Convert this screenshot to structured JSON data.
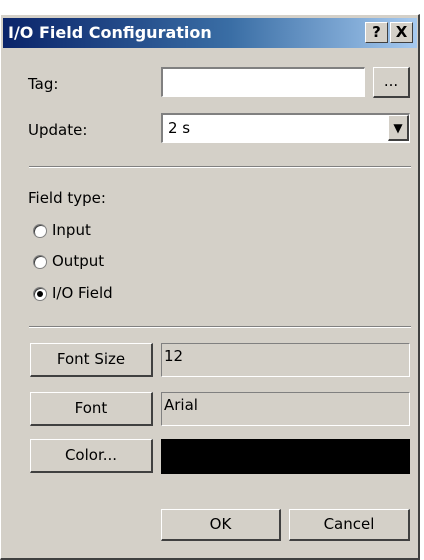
{
  "window": {
    "title": "I/O Field Configuration",
    "help_label": "?",
    "close_label": "X"
  },
  "tag": {
    "label": "Tag:",
    "value": "",
    "browse_label": "..."
  },
  "update": {
    "label": "Update:",
    "value": "2 s",
    "arrow": "▼"
  },
  "field_type": {
    "label": "Field type:",
    "options": [
      "Input",
      "Output",
      "I/O Field"
    ],
    "selected": "I/O Field"
  },
  "font_size": {
    "button_label": "Font Size",
    "value": "12"
  },
  "font": {
    "button_label": "Font",
    "value": "Arial"
  },
  "color": {
    "button_label": "Color...",
    "value": "#000000"
  },
  "actions": {
    "ok_label": "OK",
    "cancel_label": "Cancel"
  }
}
